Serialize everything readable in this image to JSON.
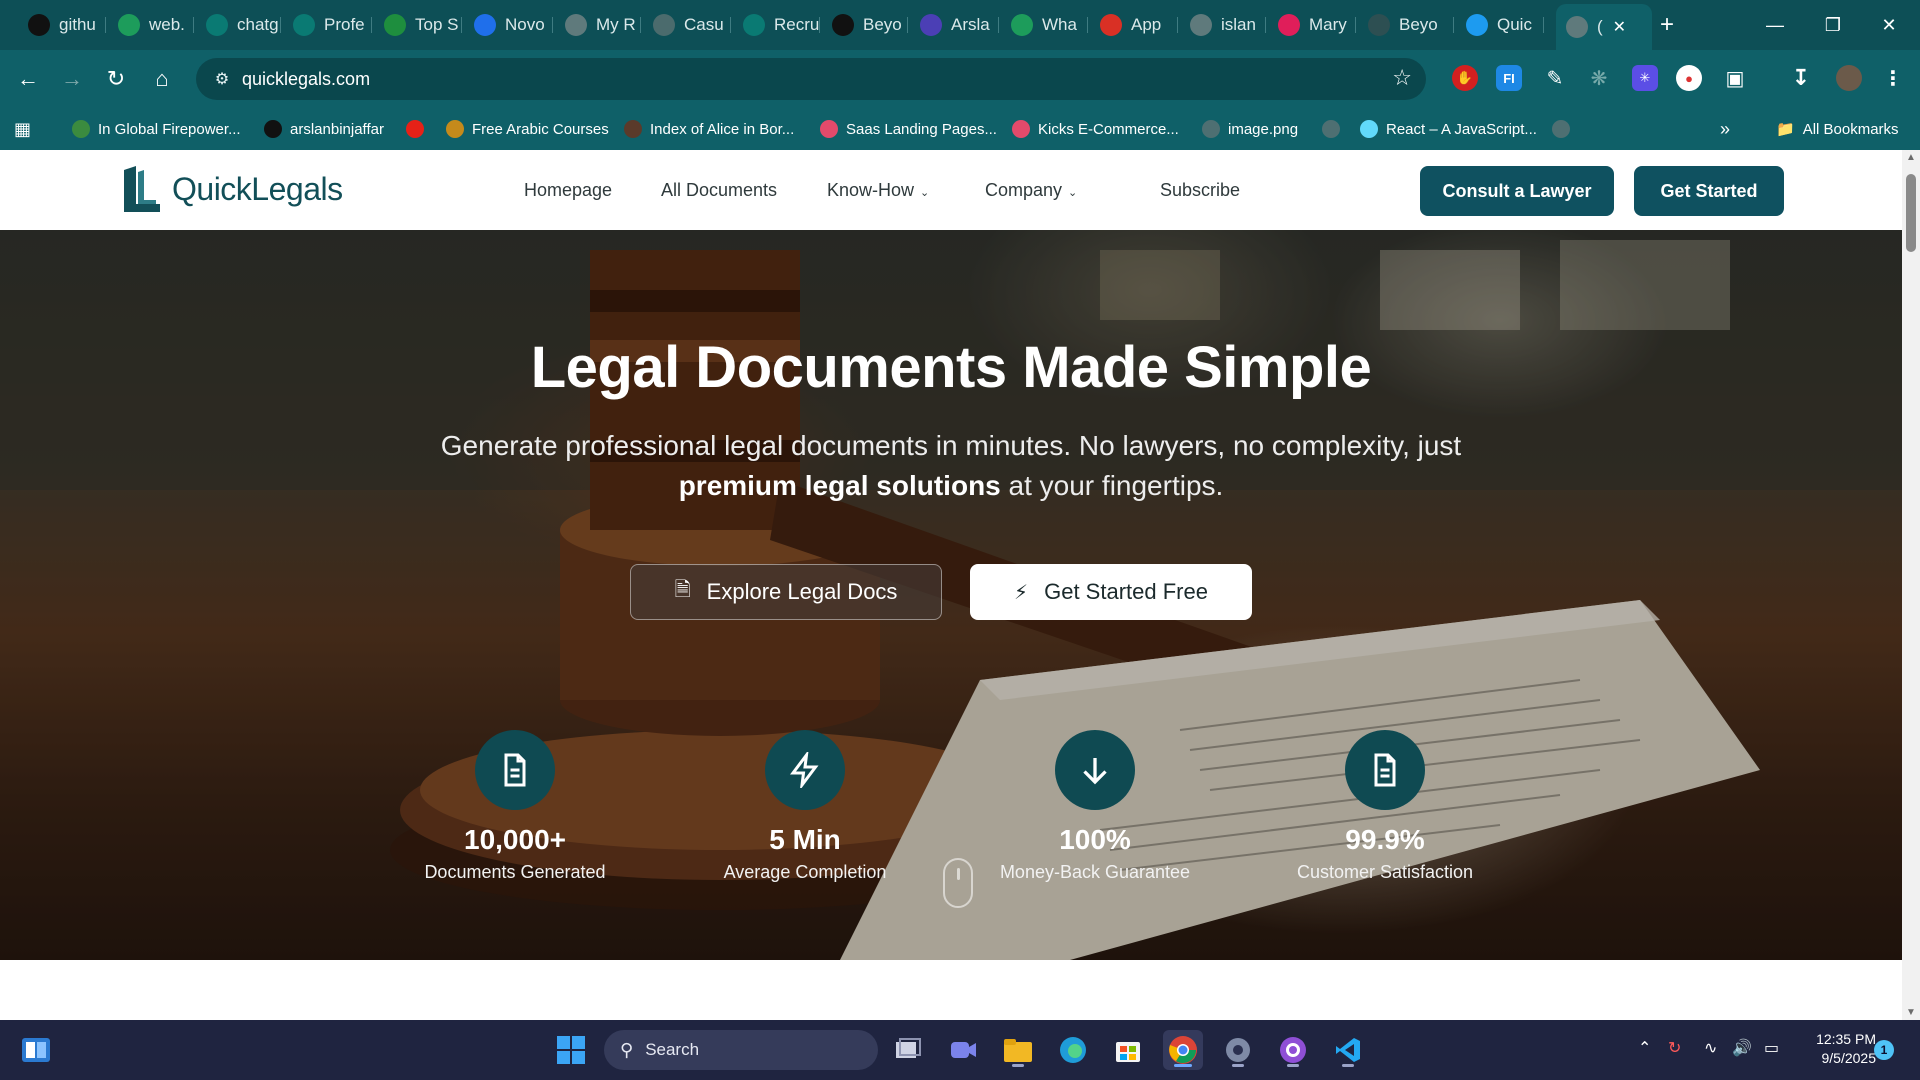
{
  "browser": {
    "tabs": [
      {
        "label": "githu",
        "icon": "github-icon",
        "color": "#111111"
      },
      {
        "label": "web.",
        "icon": "whatsapp-icon",
        "color": "#1d9c5b"
      },
      {
        "label": "chatg",
        "icon": "openai-icon",
        "color": "#0a7a73"
      },
      {
        "label": "Profe",
        "icon": "openai-icon",
        "color": "#0a7a73"
      },
      {
        "label": "Top S",
        "icon": "sheets-icon",
        "color": "#1e8e3e"
      },
      {
        "label": "Novo",
        "icon": "notion-icon",
        "color": "#1f6feb"
      },
      {
        "label": "My R",
        "icon": "globe-icon",
        "color": "#5f7a7c"
      },
      {
        "label": "Casu",
        "icon": "loop-icon",
        "color": "#4b6b6d"
      },
      {
        "label": "Recru",
        "icon": "openai-icon",
        "color": "#0a7a73"
      },
      {
        "label": "Beyo",
        "icon": "github-icon",
        "color": "#111111"
      },
      {
        "label": "Arsla",
        "icon": "spiral-icon",
        "color": "#4b3fb5"
      },
      {
        "label": "Wha",
        "icon": "whatsapp-icon",
        "color": "#1d9c5b"
      },
      {
        "label": "App",
        "icon": "app-icon",
        "color": "#d93025"
      },
      {
        "label": "islan",
        "icon": "globe-icon",
        "color": "#5f7a7c"
      },
      {
        "label": "Mary",
        "icon": "slack-icon",
        "color": "#e01e5a"
      },
      {
        "label": "Beyo",
        "icon": "tab-icon",
        "color": "#2d4f52"
      },
      {
        "label": "Quic",
        "icon": "twitter-icon",
        "color": "#1d9bf0"
      },
      {
        "label": "(",
        "icon": "globe-icon",
        "color": "#5f7a7c",
        "active": true
      }
    ],
    "url": "quicklegals.com",
    "bookmarks": [
      {
        "label": "In Global Firepower...",
        "color": "#3b8b3f"
      },
      {
        "label": "arslanbinjaffar",
        "color": "#111111"
      },
      {
        "label": "",
        "color": "#e62117"
      },
      {
        "label": "Free Arabic Courses",
        "color": "#c58a1b"
      },
      {
        "label": "Index of Alice in Bor...",
        "color": "#5a3a2a"
      },
      {
        "label": "Saas Landing Pages...",
        "color": "#e24a6b"
      },
      {
        "label": "Kicks E-Commerce...",
        "color": "#e24a6b"
      },
      {
        "label": "image.png",
        "color": "#4e6f72"
      },
      {
        "label": "",
        "color": "#4e6f72"
      },
      {
        "label": "React – A JavaScript...",
        "color": "#61dafb"
      },
      {
        "label": "",
        "color": "#4e6f72"
      }
    ],
    "all_bookmarks": "All Bookmarks"
  },
  "site": {
    "brand": "QuickLegals",
    "nav": {
      "homepage": "Homepage",
      "all_documents": "All Documents",
      "know_how": "Know-How",
      "company": "Company",
      "subscribe": "Subscribe"
    },
    "consult_button": "Consult a Lawyer",
    "get_started_button": "Get Started",
    "hero": {
      "title": "Legal Documents Made Simple",
      "subtitle_part1": "Generate professional legal documents in minutes. No lawyers, no complexity, just",
      "subtitle_bold": "premium legal solutions",
      "subtitle_part2": "at your fingertips.",
      "explore_button": "Explore Legal Docs",
      "start_free_button": "Get Started Free"
    },
    "stats": [
      {
        "value": "10,000+",
        "label": "Documents Generated",
        "icon": "document-icon"
      },
      {
        "value": "5 Min",
        "label": "Average Completion",
        "icon": "lightning-icon"
      },
      {
        "value": "100%",
        "label": "Money-Back Guarantee",
        "icon": "arrow-down-icon"
      },
      {
        "value": "99.9%",
        "label": "Customer Satisfaction",
        "icon": "document-icon"
      }
    ],
    "colors": {
      "brand": "#0f5160",
      "chrome": "#0f6068"
    }
  },
  "taskbar": {
    "search_placeholder": "Search",
    "time": "12:35 PM",
    "date": "9/5/2025",
    "notifications": "1"
  }
}
